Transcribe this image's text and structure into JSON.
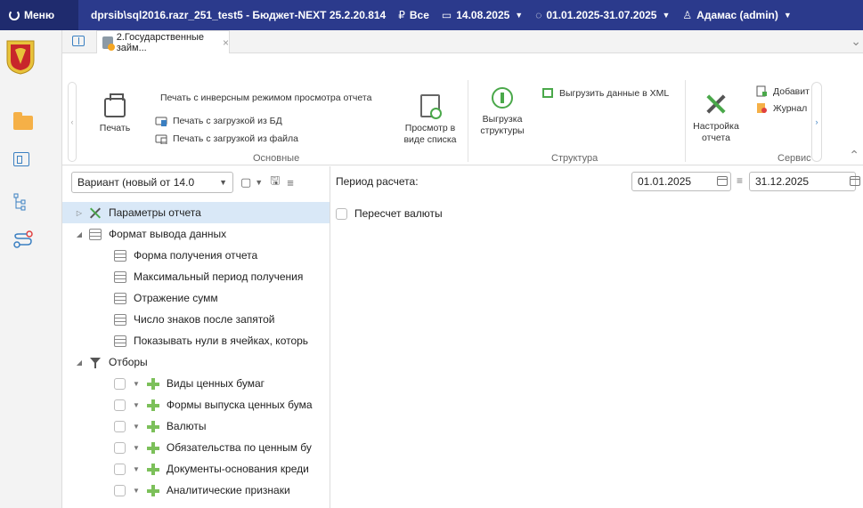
{
  "topbar": {
    "menu_label": "Меню",
    "connection": "dprsib\\sql2016.razr_251_test5 - Бюджет-NEXT 25.2.20.814",
    "scope": "Все",
    "date": "14.08.2025",
    "period": "01.01.2025-31.07.2025",
    "user": "Адамас (admin)"
  },
  "tab": {
    "title": "2.Государственные займ...",
    "close": "×"
  },
  "ribbon": {
    "print_label": "Печать",
    "print_inverse": "Печать с инверсным режимом просмотра отчета",
    "print_db": "Печать с загрузкой из БД",
    "print_file": "Печать с загрузкой из файла",
    "view_list_line1": "Просмотр в",
    "view_list_line2": "виде списка",
    "group_main": "Основные",
    "export_struct_line1": "Выгрузка",
    "export_struct_line2": "структуры",
    "export_xml": "Выгрузить данные в XML",
    "group_struct": "Структура",
    "settings_line1": "Настройка",
    "settings_line2": "отчета",
    "add": "Добавит",
    "journal": "Журнал",
    "group_service": "Сервис"
  },
  "variant": {
    "value": "Вариант (новый от 14.0"
  },
  "tree": {
    "params": "Параметры отчета",
    "output_format": "Формат вывода данных",
    "get_form": "Форма получения отчета",
    "max_period": "Максимальный период получения",
    "sums": "Отражение сумм",
    "decimals": "Число знаков после запятой",
    "show_zeros": "Показывать нули в ячейках, которь",
    "filters": "Отборы",
    "f1": "Виды ценных бумаг",
    "f2": "Формы выпуска ценных бума",
    "f3": "Валюты",
    "f4": "Обязательства по ценным бу",
    "f5": "Документы-основания креди",
    "f6": "Аналитические признаки"
  },
  "right": {
    "period_label": "Период расчета:",
    "date_from": "01.01.2025",
    "date_to": "31.12.2025",
    "recalc_currency": "Пересчет валюты"
  }
}
